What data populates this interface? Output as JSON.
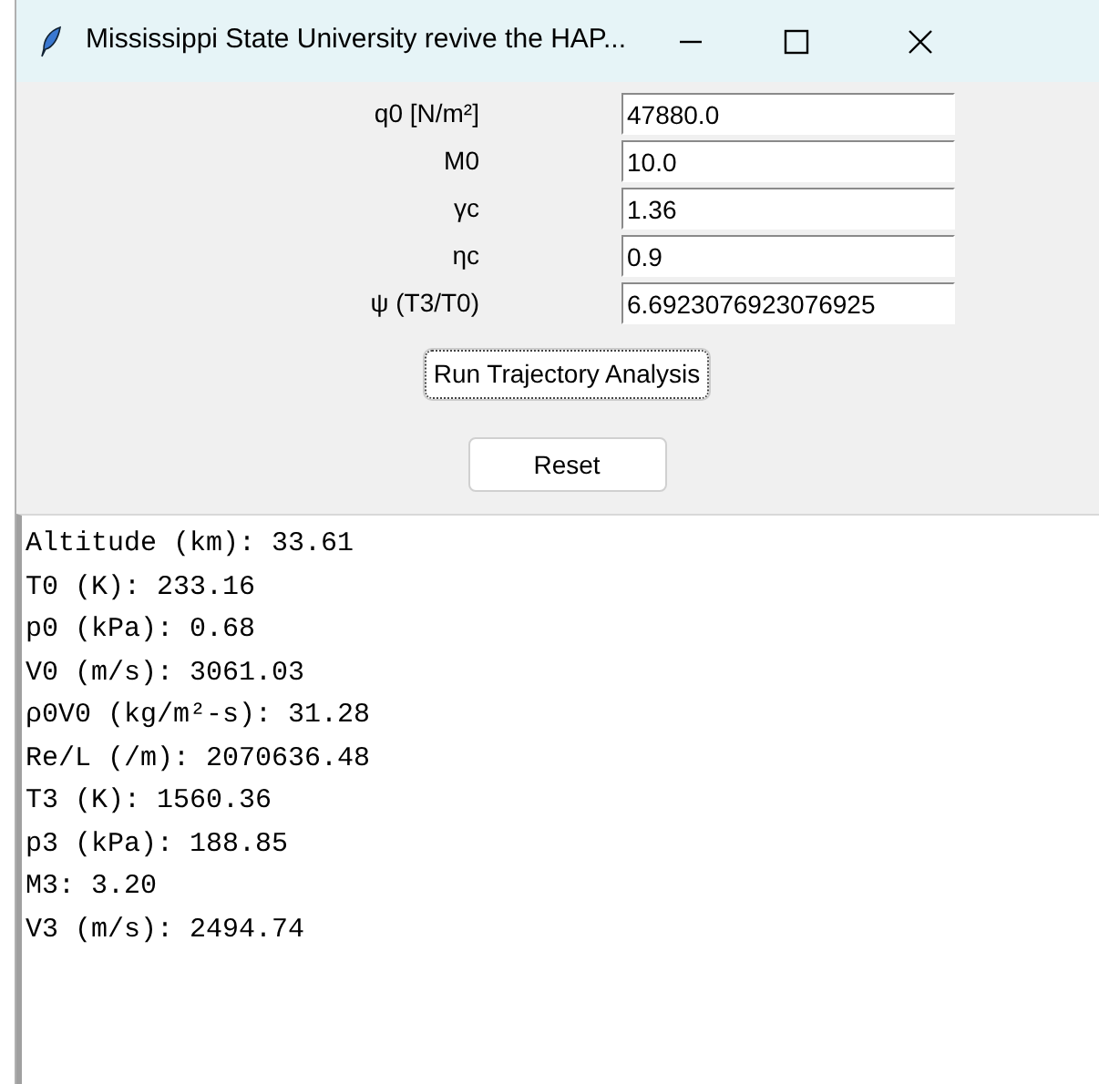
{
  "window": {
    "title": "Mississippi State University revive the HAP..."
  },
  "fields": [
    {
      "label": "q0 [N/m²]",
      "value": "47880.0"
    },
    {
      "label": "M0",
      "value": "10.0"
    },
    {
      "label": "γc",
      "value": "1.36"
    },
    {
      "label": "ηc",
      "value": "0.9"
    },
    {
      "label": "ψ (T3/T0)",
      "value": "6.6923076923076925"
    }
  ],
  "buttons": [
    {
      "label": "Run Trajectory Analysis",
      "focused": true
    },
    {
      "label": "Reset",
      "focused": false
    }
  ],
  "output": [
    "Altitude (km): 33.61",
    "T0 (K): 233.16",
    "p0 (kPa): 0.68",
    "V0 (m/s): 3061.03",
    "ρ0V0 (kg/m²-s): 31.28",
    "Re/L (/m): 2070636.48",
    "T3 (K): 1560.36",
    "p3 (kPa): 188.85",
    "M3: 3.20",
    "V3 (m/s): 2494.74"
  ]
}
